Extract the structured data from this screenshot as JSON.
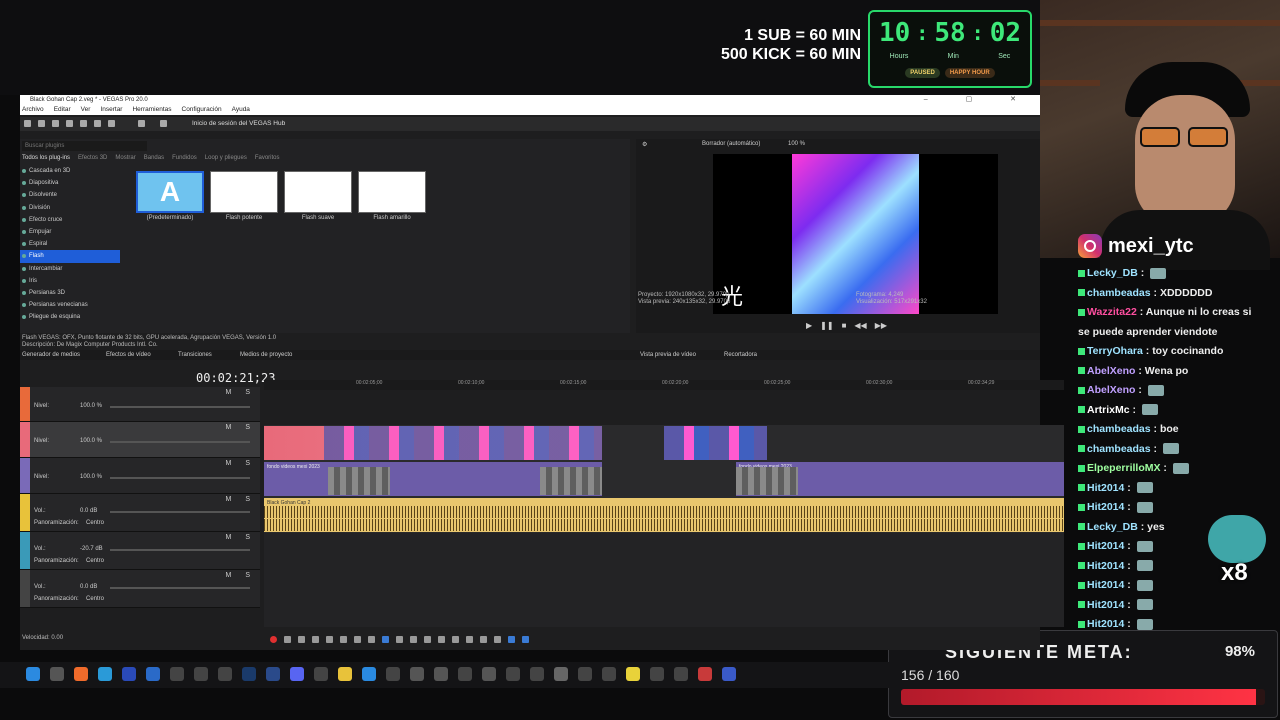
{
  "stream": {
    "promo_line1": "1 SUB = 60 MIN",
    "promo_line2": "500 KICK = 60 MIN",
    "timer": {
      "hours": "10",
      "minutes": "58",
      "seconds": "02",
      "hours_label": "Hours",
      "minutes_label": "Min",
      "seconds_label": "Sec",
      "paused_label": "PAUSED",
      "happy_label": "HAPPY HOUR",
      "accent": "#3ee87a"
    },
    "instagram": "mexi_ytc",
    "chat": [
      {
        "user": "Lecky_DB",
        "msg": "",
        "color": "#9fe3ff"
      },
      {
        "user": "chambeadas",
        "msg": "XDDDDDD",
        "color": "#9fe3ff"
      },
      {
        "user": "Wazzita22",
        "msg": "Aunque ni lo creas si",
        "color": "#ff4fa0"
      },
      {
        "user": "",
        "msg": "se puede aprender viendote",
        "color": "#eee"
      },
      {
        "user": "TerryOhara",
        "msg": "toy cocinando",
        "color": "#9fe3ff"
      },
      {
        "user": "AbelXeno",
        "msg": "Wena po",
        "color": "#c0a0ff"
      },
      {
        "user": "AbelXeno",
        "msg": "",
        "color": "#c0a0ff"
      },
      {
        "user": "ArtrixMc",
        "msg": "",
        "color": "#ffffff"
      },
      {
        "user": "chambeadas",
        "msg": "boe",
        "color": "#9fe3ff"
      },
      {
        "user": "chambeadas",
        "msg": "",
        "color": "#9fe3ff"
      },
      {
        "user": "ElpeperrilloMX",
        "msg": "",
        "color": "#9fffa0"
      },
      {
        "user": "Hit2014",
        "msg": "",
        "color": "#9fe3ff"
      },
      {
        "user": "Hit2014",
        "msg": "",
        "color": "#9fe3ff"
      },
      {
        "user": "Lecky_DB",
        "msg": "yes",
        "color": "#9fe3ff"
      },
      {
        "user": "Hit2014",
        "msg": "",
        "color": "#9fe3ff"
      },
      {
        "user": "Hit2014",
        "msg": "",
        "color": "#9fe3ff"
      },
      {
        "user": "Hit2014",
        "msg": "",
        "color": "#9fe3ff"
      },
      {
        "user": "Hit2014",
        "msg": "",
        "color": "#9fe3ff"
      },
      {
        "user": "Hit2014",
        "msg": "",
        "color": "#9fe3ff"
      }
    ],
    "sticker_count": "x8",
    "goal": {
      "title": "SIGUIENTE META:",
      "percent": "98%",
      "count": "156 / 160",
      "progress": 0.975
    }
  },
  "vegas": {
    "title": "Black Gohan Cap 2.veg * - VEGAS Pro 20.0",
    "menu": [
      "Archivo",
      "Editar",
      "Ver",
      "Insertar",
      "Herramientas",
      "Configuración",
      "Ayuda"
    ],
    "hub_label": "Inicio de sesión del VEGAS Hub",
    "search_placeholder": "Buscar plugins",
    "fx_tabs": [
      "Todos los plug-ins",
      "Efectos 3D",
      "Mostrar",
      "Bandas",
      "Fundidos",
      "Loop y pliegues",
      "Favoritos"
    ],
    "fx_list": [
      "Cascada en 3D",
      "Diapositiva",
      "Disolvente",
      "División",
      "Efecto cruce",
      "Empujar",
      "Espiral",
      "Flash",
      "Intercambiar",
      "Iris",
      "Persianas 3D",
      "Persianas venecianas",
      "Pliegue de esquina"
    ],
    "fx_selected": "Flash",
    "presets": [
      {
        "label": "(Predeterminado)",
        "glyph": "A"
      },
      {
        "label": "Flash potente",
        "glyph": ""
      },
      {
        "label": "Flash suave",
        "glyph": ""
      },
      {
        "label": "Flash amarillo",
        "glyph": ""
      }
    ],
    "fx_desc_line1": "Flash VEGAS: OFX, Punto flotante de 32 bits, GPU acelerada, Agrupación VEGAS, Versión 1.0",
    "fx_desc_line2": "Descripción: De Magix Computer Products Intl. Co.",
    "preview_mode": "Borrador (automático)",
    "preview_zoom": "100 %",
    "preview_project": "Proyecto: 1920x1080x32, 29.970p",
    "preview_vista": "Vista previa: 240x135x32, 29.970p",
    "preview_frame": "Fotograma: 4,249",
    "preview_display": "Visualización: 517x291x32",
    "kanji": "光",
    "tabs": [
      "Generador de medios",
      "Efectos de vídeo",
      "Transiciones",
      "Medios de proyecto",
      "Vista previa de vídeo",
      "Recortadora"
    ],
    "timecode": "00:02:21;23",
    "ruler": [
      "00:02:05;00",
      "00:02:10;00",
      "00:02:15;00",
      "00:02:20;00",
      "00:02:25;00",
      "00:02:30;00",
      "00:02:34;29"
    ],
    "tracks": [
      {
        "label": "Nivel:",
        "value": "100.0 %"
      },
      {
        "label": "Nivel:",
        "value": "100.0 %"
      },
      {
        "label": "Nivel:",
        "value": "100.0 %"
      },
      {
        "label": "Vol.:",
        "value": "0.0 dB",
        "pan_label": "Panoramización:",
        "pan": "Centro"
      },
      {
        "label": "Vol.:",
        "value": "-20.7 dB",
        "pan_label": "Panoramización:",
        "pan": "Centro"
      },
      {
        "label": "Vol.:",
        "value": "0.0 dB",
        "pan_label": "Panoramización:",
        "pan": "Centro"
      }
    ],
    "clip_fondo1": "fondo videos mexi 2023",
    "clip_fondo2": "fondo videos mexi 2023",
    "clip_audio": "Black Gohan Cap 2",
    "speed": "Velocidad: 0.00"
  }
}
